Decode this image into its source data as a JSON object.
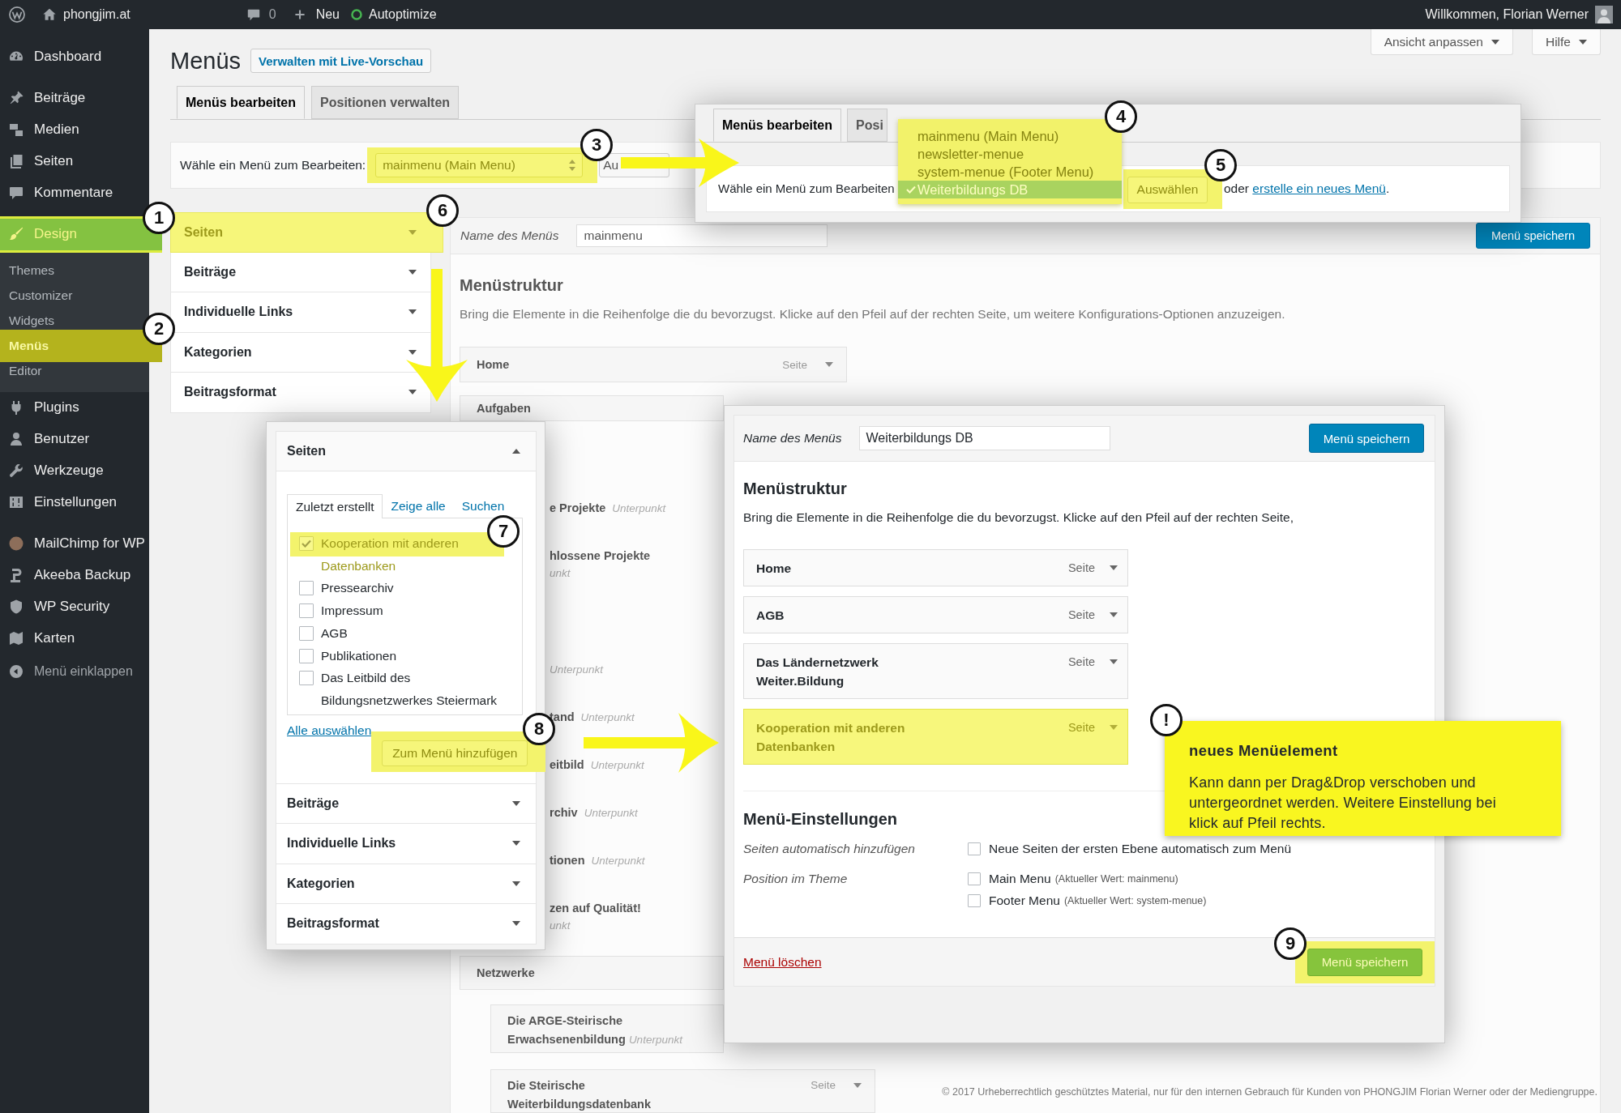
{
  "admin_bar": {
    "site_name": "phongjim.at",
    "comment_count": "0",
    "new_label": "Neu",
    "plugin_label": "Autoptimize",
    "greeting": "Willkommen, Florian Werner"
  },
  "sidebar": {
    "groups": [
      {
        "items": [
          {
            "label": "Dashboard",
            "selected": false
          }
        ]
      },
      {
        "items": [
          {
            "label": "Beiträge",
            "selected": false
          },
          {
            "label": "Medien",
            "selected": false
          },
          {
            "label": "Seiten",
            "selected": false
          },
          {
            "label": "Kommentare",
            "selected": false
          }
        ]
      },
      {
        "items": [
          {
            "label": "Design",
            "selected": true,
            "children": [
              {
                "label": "Themes",
                "selected": false
              },
              {
                "label": "Customizer",
                "selected": false
              },
              {
                "label": "Widgets",
                "selected": false
              },
              {
                "label": "Menüs",
                "selected": true
              },
              {
                "label": "Editor",
                "selected": false
              }
            ]
          },
          {
            "label": "Plugins",
            "selected": false
          },
          {
            "label": "Benutzer",
            "selected": false
          },
          {
            "label": "Werkzeuge",
            "selected": false
          },
          {
            "label": "Einstellungen",
            "selected": false
          }
        ]
      },
      {
        "items": [
          {
            "label": "MailChimp for WP",
            "selected": false
          },
          {
            "label": "Akeeba Backup",
            "selected": false
          },
          {
            "label": "WP Security",
            "selected": false
          },
          {
            "label": "Karten",
            "selected": false
          }
        ]
      }
    ],
    "collapse_label": "Menü einklappen"
  },
  "screen_meta": [
    {
      "label": "Ansicht anpassen"
    },
    {
      "label": "Hilfe"
    }
  ],
  "page": {
    "title": "Menüs",
    "live_preview_button": "Verwalten mit Live-Vorschau"
  },
  "tabs": [
    {
      "label": "Menüs bearbeiten",
      "selected": true
    },
    {
      "label": "Positionen verwalten",
      "selected": false
    }
  ],
  "menu_select": {
    "label": "Wähle ein Menü zum Bearbeiten:",
    "value": "mainmenu (Main Menu)",
    "highlighted": true,
    "button": "Au"
  },
  "accordion": [
    {
      "title": "Seiten",
      "expanded": false,
      "highlighted": true
    },
    {
      "title": "Beiträge",
      "expanded": false,
      "highlighted": false
    },
    {
      "title": "Individuelle Links",
      "expanded": false,
      "highlighted": false
    },
    {
      "title": "Kategorien",
      "expanded": false,
      "highlighted": false
    },
    {
      "title": "Beitragsformat",
      "expanded": false,
      "highlighted": false
    }
  ],
  "menu_editor": {
    "name_label": "Name des Menüs",
    "name_value": "mainmenu",
    "save_button": "Menü speichern",
    "heading": "Menüstruktur",
    "description": "Bring die Elemente in die Reihenfolge die du bevorzugst. Klicke auf den Pfeil auf der rechten Seite, um weitere Konfigurations-Optionen anzuzeigen.",
    "items": [
      {
        "title": "Home",
        "type": "Seite"
      },
      {
        "title": "Aufgaben"
      }
    ],
    "partial_items": [
      {
        "title": "e Projekte",
        "sub": "Unterpunkt"
      },
      {
        "title": "hlossene Projekte",
        "next_line": "unkt"
      },
      {
        "sub": "Unterpunkt"
      },
      {
        "title": "tand",
        "sub": "Unterpunkt"
      },
      {
        "title": "eitbild",
        "sub": "Unterpunkt"
      },
      {
        "title": "rchiv",
        "sub": "Unterpunkt"
      },
      {
        "title": "tionen",
        "sub": "Unterpunkt"
      },
      {
        "title": "zen auf Qualität!",
        "next_line": "unkt"
      }
    ],
    "lower_items": [
      {
        "title": "Netzwerke",
        "children": [
          {
            "title": "Die ARGE-Steirische Erwachsenenbildung",
            "sub": "Unterpunkt"
          },
          {
            "title": "Die Steirische Weiterbildungsdatenbank",
            "type": "Seite"
          }
        ]
      }
    ]
  },
  "zoom_select": {
    "tabs": [
      {
        "label": "Menüs bearbeiten",
        "selected": true
      },
      {
        "label": "Posi",
        "selected": false
      }
    ],
    "label": "Wähle ein Menü zum Bearbeiten",
    "list_highlighted": true,
    "options": [
      {
        "label": "mainmenu (Main Menu)",
        "selected": false
      },
      {
        "label": "newsletter-menue",
        "selected": false
      },
      {
        "label": "system-menue (Footer Menu)",
        "selected": false
      },
      {
        "label": "Weiterbildungs DB",
        "selected": true
      }
    ],
    "button": "Auswählen",
    "button_highlighted": true,
    "create_before": "oder",
    "create_link": "erstelle ein neues Menü",
    "create_after": "."
  },
  "zoom_pages": {
    "title": "Seiten",
    "expanded": true,
    "tabs": [
      {
        "label": "Zuletzt erstellt",
        "selected": true
      },
      {
        "label": "Zeige alle",
        "selected": false
      },
      {
        "label": "Suchen",
        "selected": false
      }
    ],
    "pages": [
      {
        "label": "Kooperation mit anderen Datenbanken",
        "checked": true,
        "highlighted": true
      },
      {
        "label": "Pressearchiv",
        "checked": false,
        "highlighted": false
      },
      {
        "label": "Impressum",
        "checked": false,
        "highlighted": false
      },
      {
        "label": "AGB",
        "checked": false,
        "highlighted": false
      },
      {
        "label": "Publikationen",
        "checked": false,
        "highlighted": false
      },
      {
        "label": "Das Leitbild des Bildungsnetzwerkes Steiermark",
        "checked": false,
        "highlighted": false
      }
    ],
    "select_all": "Alle auswählen",
    "add_button": "Zum Menü hinzufügen",
    "add_highlighted": true,
    "sections": [
      {
        "title": "Beiträge",
        "expanded": false
      },
      {
        "title": "Individuelle Links",
        "expanded": false
      },
      {
        "title": "Kategorien",
        "expanded": false
      },
      {
        "title": "Beitragsformat",
        "expanded": false
      }
    ]
  },
  "zoom_editor": {
    "name_label": "Name des Menüs",
    "name_value": "Weiterbildungs DB",
    "save_button": "Menü speichern",
    "heading": "Menüstruktur",
    "description": "Bring die Elemente in die Reihenfolge die du bevorzugst. Klicke auf den Pfeil auf der rechten Seite,",
    "items": [
      {
        "title": "Home",
        "type": "Seite",
        "highlighted": false
      },
      {
        "title": "AGB",
        "type": "Seite",
        "highlighted": false
      },
      {
        "title": "Das Ländernetzwerk Weiter.Bildung",
        "type": "Seite",
        "highlighted": false
      },
      {
        "title": "Kooperation mit anderen Datenbanken",
        "type": "Seite",
        "highlighted": true
      }
    ],
    "settings_heading": "Menü-Einstellungen",
    "settings": [
      {
        "label": "Seiten automatisch hinzufügen",
        "options": [
          {
            "label": "Neue Seiten der ersten Ebene automatisch zum Menü",
            "checked": false
          }
        ]
      },
      {
        "label": "Position im Theme",
        "options": [
          {
            "label": "Main Menu",
            "note": "(Aktueller Wert: mainmenu)",
            "checked": false
          },
          {
            "label": "Footer Menu",
            "note": "(Aktueller Wert: system-menue)",
            "checked": false
          }
        ]
      }
    ],
    "delete_link": "Menü löschen",
    "save_bottom": "Menü speichern",
    "save_bottom_highlighted": true
  },
  "callout": {
    "title": "neues Menüelement",
    "text": "Kann dann per Drag&Drop verschoben und untergeordnet werden. Weitere Einstellung bei klick auf Pfeil rechts."
  },
  "markers": [
    "1",
    "2",
    "3",
    "4",
    "5",
    "6",
    "7",
    "8",
    "9",
    "!"
  ],
  "footer": "© 2017 Urheberrechtlich geschütztes Material, nur für den internen Gebrauch für Kunden von PHONGJIM Florian Werner oder der Mediengruppe."
}
